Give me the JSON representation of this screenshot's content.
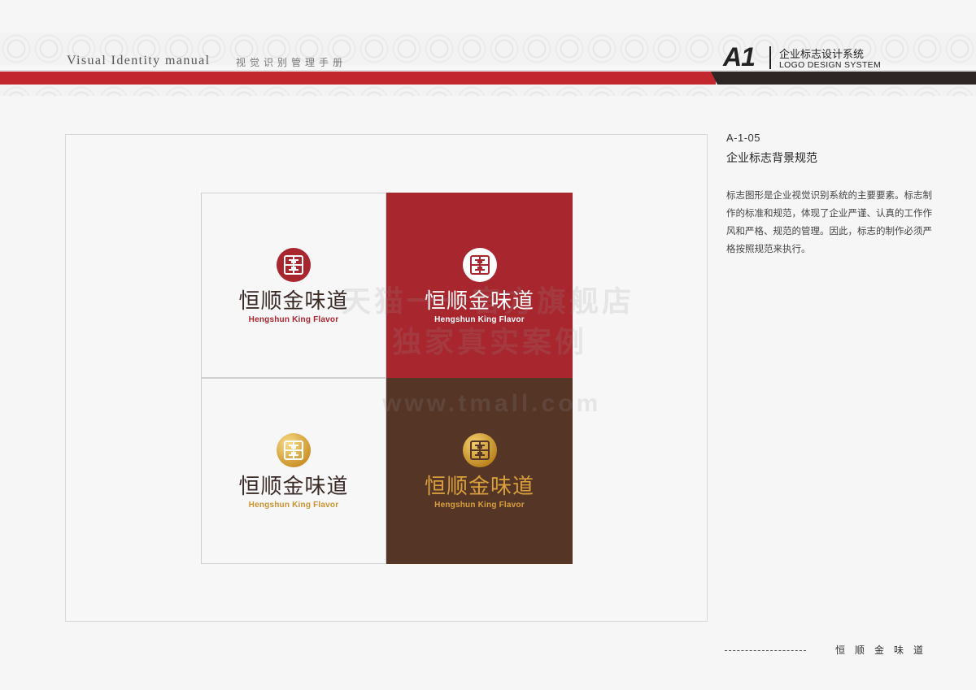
{
  "header": {
    "brand_en": "Visual Identity  manual",
    "brand_cn": "视觉识别管理手册",
    "code": "A1",
    "section_cn": "企业标志设计系统",
    "section_en": "LOGO DESIGN SYSTEM"
  },
  "logo": {
    "cn": "恒顺金味道",
    "en": "Hengshun King Flavor"
  },
  "variants": [
    {
      "bg": "#f7f7f7",
      "emblem": "#a8262e",
      "emblem_inner": "#ffffff",
      "cn_color": "#3a2a25",
      "en_color": "#a8262e"
    },
    {
      "bg": "#a8262e",
      "emblem": "#ffffff",
      "emblem_inner": "#a8262e",
      "cn_color": "#ffffff",
      "en_color": "#ffffff"
    },
    {
      "bg": "#f7f7f7",
      "emblem": "#d8a93c",
      "emblem_inner": "#ffffff",
      "cn_color": "#3a2a25",
      "en_color": "#c9922e"
    },
    {
      "bg": "#553526",
      "emblem": "#d8a93c",
      "emblem_inner": "#553526",
      "cn_color": "#d8a03c",
      "en_color": "#d8a03c"
    }
  ],
  "watermark": {
    "line1": "天猫一一官方旗舰店",
    "line2": "独家真实案例",
    "line3": "www.tmall.com"
  },
  "side": {
    "code": "A-1-05",
    "title": "企业标志背景规范",
    "body": "标志图形是企业视觉识别系统的主要要素。标志制作的标准和规范，体现了企业严谨、认真的工作作风和严格、规范的管理。因此，标志的制作必须严格按照规范来执行。"
  },
  "footer": {
    "name": "恒顺金味道"
  }
}
